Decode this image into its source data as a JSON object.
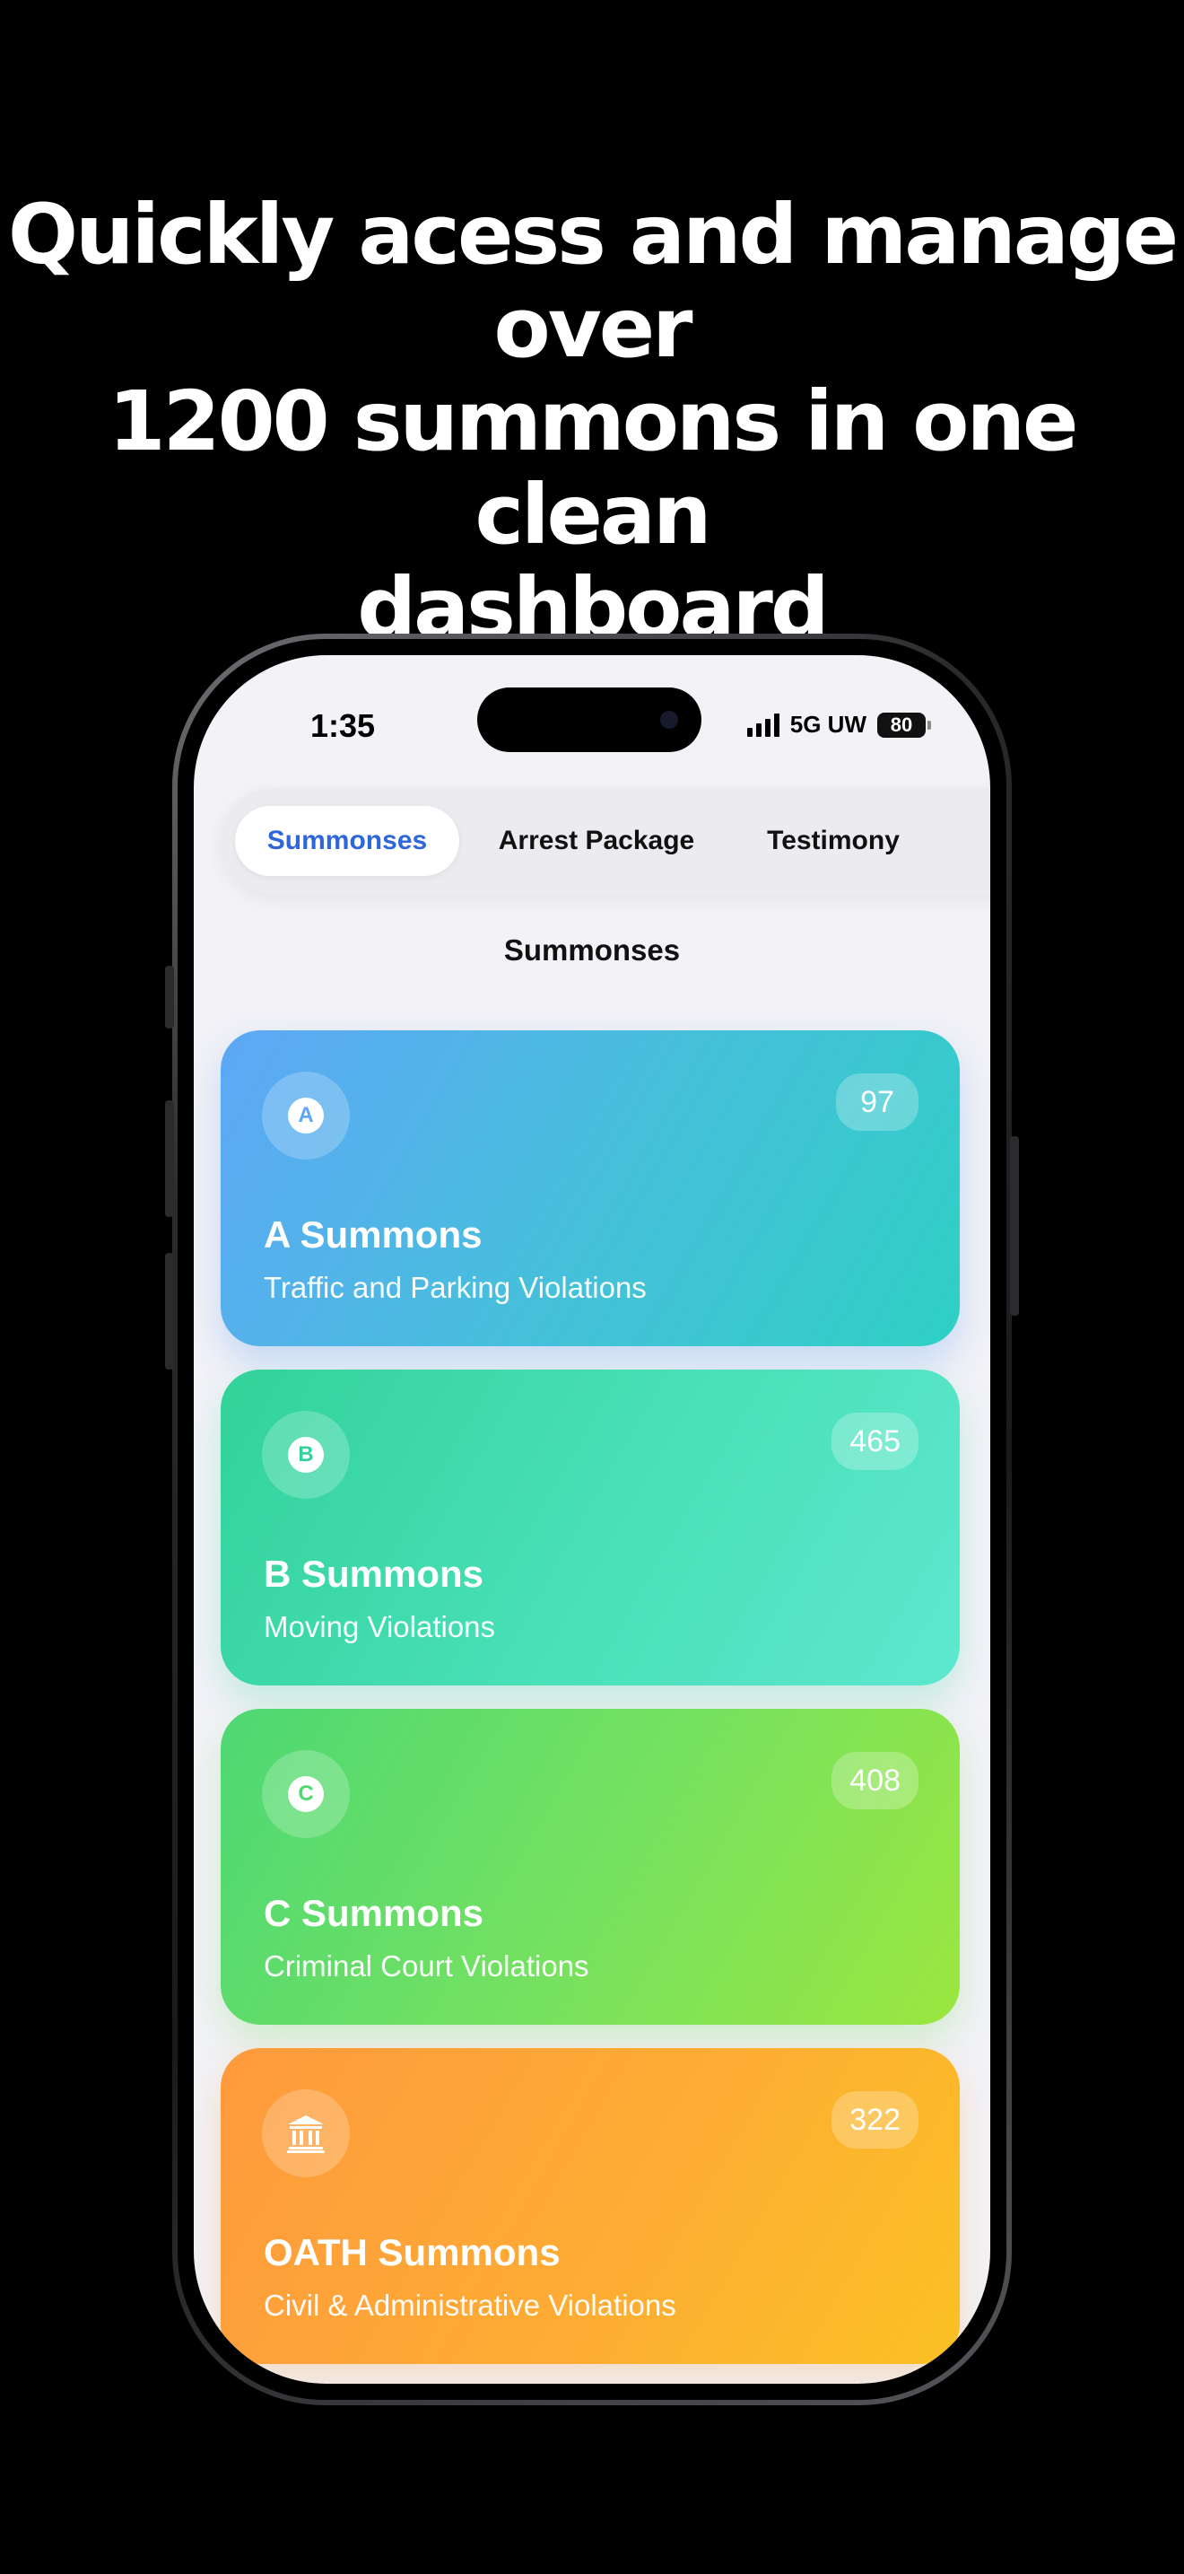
{
  "headline": {
    "line1": "Quickly acess and manage over",
    "line2": "1200 summons in one clean",
    "line3": "dashboard"
  },
  "status_bar": {
    "time": "1:35",
    "network": "5G UW",
    "battery": "80"
  },
  "tabs": [
    {
      "label": "Summonses",
      "active": true
    },
    {
      "label": "Arrest Package",
      "active": false
    },
    {
      "label": "Testimony",
      "active": false
    }
  ],
  "section_title": "Summonses",
  "cards": [
    {
      "icon": "letter-a-icon",
      "letter": "A",
      "count": "97",
      "title": "A Summons",
      "subtitle": "Traffic and Parking Violations",
      "color": "#47bfdc"
    },
    {
      "icon": "letter-b-icon",
      "letter": "B",
      "count": "465",
      "title": "B Summons",
      "subtitle": "Moving Violations",
      "color": "#48dfb6"
    },
    {
      "icon": "letter-c-icon",
      "letter": "C",
      "count": "408",
      "title": "C Summons",
      "subtitle": "Criminal Court Violations",
      "color": "#78e25e"
    },
    {
      "icon": "courthouse-icon",
      "letter": "",
      "count": "322",
      "title": "OATH Summons",
      "subtitle": "Civil & Administrative Violations",
      "color": "#fdac34"
    }
  ],
  "colors": {
    "active_tab": "#2f67d8",
    "background": "#000000",
    "screen": "#f2f2f7"
  }
}
